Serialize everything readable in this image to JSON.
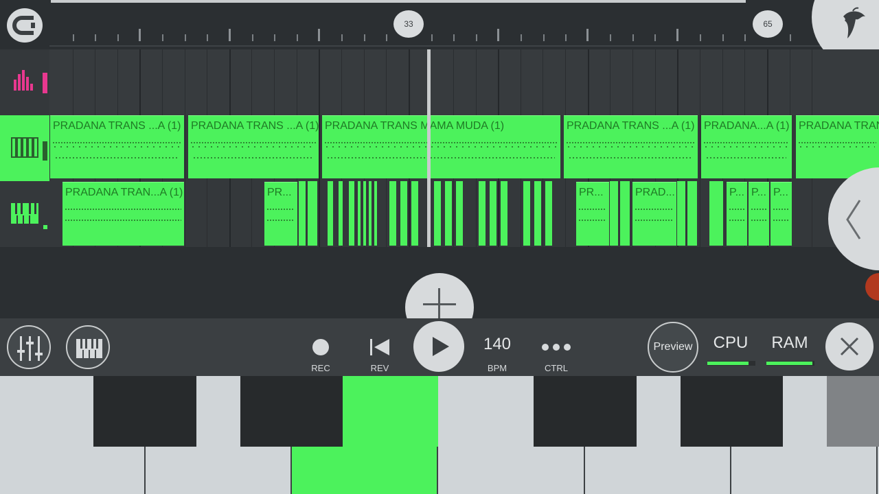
{
  "ruler": {
    "markers": [
      "33",
      "65"
    ]
  },
  "tracks": [
    {
      "name": "mixer-levels-track"
    },
    {
      "name": "piano-roll-track-1"
    },
    {
      "name": "piano-roll-track-2"
    }
  ],
  "lane2_clips": [
    "PRADANA TRANS ...A (1)",
    "PRADANA TRANS ...A (1)",
    "PRADANA TRANS MAMA MUDA (1)",
    "PRADANA TRANS ...A (1)",
    "PRADANA...A (1)",
    "PRADANA TRAN"
  ],
  "lane3_clips": [
    "PRADANA TRAN...A (1)",
    "PR...",
    "PR...",
    "PRAD...",
    "P...",
    "P...",
    "P..."
  ],
  "transport": {
    "rec_label": "REC",
    "rev_label": "REV",
    "bpm_value": "140",
    "bpm_label": "BPM",
    "ctrl_label": "CTRL",
    "preview_label": "Preview",
    "cpu_label": "CPU",
    "ram_label": "RAM",
    "cpu_level": 0.85,
    "ram_level": 0.95
  },
  "colors": {
    "clip": "#4cf25c",
    "clip_text": "#1f7a25",
    "background": "#2b2f32",
    "button": "#d7dadc",
    "mixer_icon": "#e8388f",
    "record": "#b2391f"
  },
  "keyboard": {
    "active_key": "white-key-3"
  }
}
